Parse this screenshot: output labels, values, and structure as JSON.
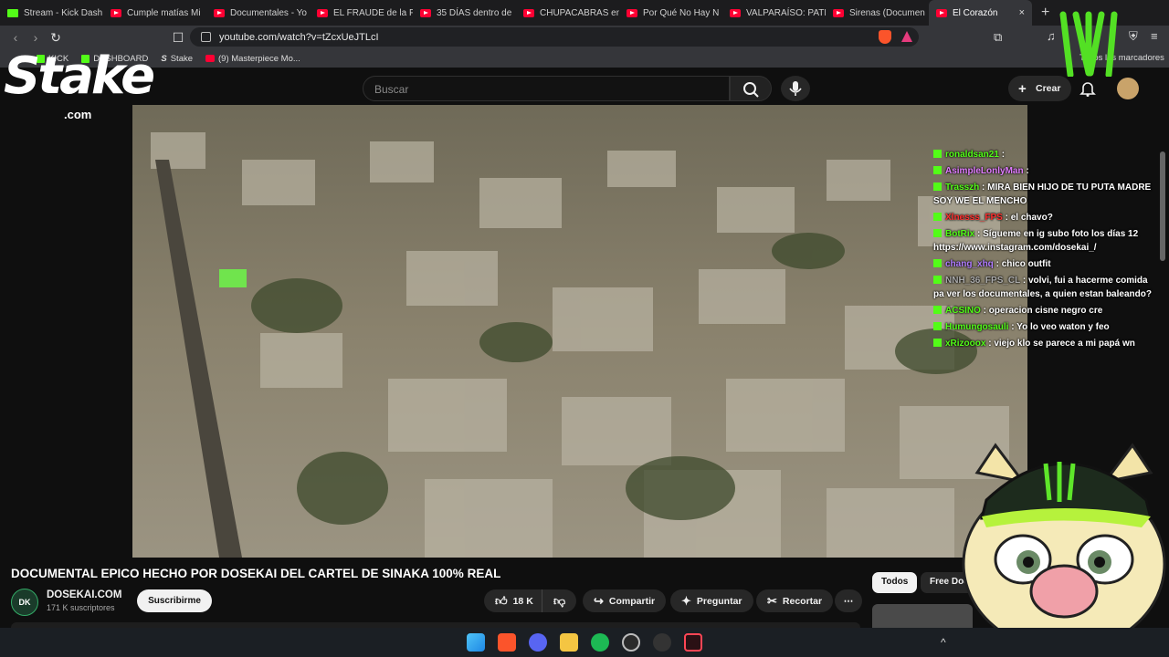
{
  "tabs": [
    {
      "label": "Stream - Kick Dash",
      "type": "kick"
    },
    {
      "label": "Cumple matías Mi",
      "type": "yt"
    },
    {
      "label": "Documentales - Yo",
      "type": "yt"
    },
    {
      "label": "EL FRAUDE de la FIF",
      "type": "yt"
    },
    {
      "label": "35 DÍAS dentro de",
      "type": "yt"
    },
    {
      "label": "CHUPACABRAS en",
      "type": "yt"
    },
    {
      "label": "Por Qué No Hay N",
      "type": "yt"
    },
    {
      "label": "VALPARAÍSO: PATR",
      "type": "yt"
    },
    {
      "label": "Sirenas (Documen",
      "type": "yt"
    },
    {
      "label": "El Corazón",
      "type": "yt",
      "active": true
    }
  ],
  "tab_close": "×",
  "new_tab": "+",
  "url": "youtube.com/watch?v=tZcxUeJTLcI",
  "bookmarks": [
    {
      "label": "KICK",
      "icon": "kick"
    },
    {
      "label": "DASHBOARD",
      "icon": "kick"
    },
    {
      "label": "Stake",
      "icon": "stake"
    },
    {
      "label": "(9) Masterpiece Mo...",
      "icon": "yt"
    }
  ],
  "bookmarks_right": "Todos los marcadores",
  "search_placeholder": "Buscar",
  "create_label": "Crear",
  "overlay": {
    "logo": "Stake",
    ".com": ".com",
    "logo_com": ".com"
  },
  "video": {
    "title": "DOCUMENTAL EPICO HECHO POR DOSEKAI DEL CARTEL DE SINAKA 100% REAL",
    "channel": "DOSEKAI.COM",
    "channel_initials": "DK",
    "subscribers": "171 K suscriptores",
    "subscribe": "Suscribirme",
    "likes": "18 K",
    "share": "Compartir",
    "ask": "Preguntar",
    "clip": "Recortar",
    "more": "⋯"
  },
  "chips": [
    "Todos",
    "Free Doc"
  ],
  "chat": [
    {
      "user": "ronaldsan21",
      "color": "#53fc18",
      "text": ""
    },
    {
      "user": "AsimpleLonlyMan",
      "color": "#e07cff",
      "text": ""
    },
    {
      "user": "Trasszh",
      "color": "#53fc18",
      "text": "MIRA BIEN HIJO DE TU PUTA MADRE SOY  WE EL MENCHO"
    },
    {
      "user": "Xlnesss_FPS",
      "color": "#ff2e2e",
      "text": "el chavo?"
    },
    {
      "user": "BotRix",
      "color": "#53fc18",
      "text": "Sígueme en ig subo foto los días 12 https://www.instagram.com/dosekai_/"
    },
    {
      "user": "chang_xhq",
      "color": "#b07cff",
      "text": "chico outfit"
    },
    {
      "user": "NNH_36_FPS_CL",
      "color": "#aaaaaa",
      "text": "volvi, fui a hacerme comida pa ver los documentales, a quien estan baleando?"
    },
    {
      "user": "ACSINO",
      "color": "#53fc18",
      "text": "operacion cisne negro cre"
    },
    {
      "user": "Humungosauli",
      "color": "#53fc18",
      "text": "Yo lo veo waton y feo"
    },
    {
      "user": "xRizooox",
      "color": "#53fc18",
      "text": "viejo klo se parece a mi papá wn"
    }
  ]
}
